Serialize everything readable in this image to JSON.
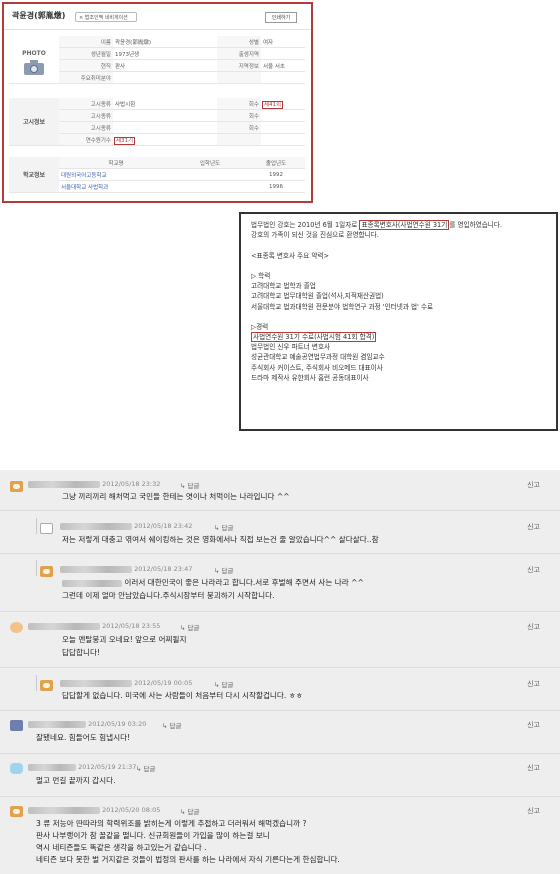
{
  "profile": {
    "name": "곽윤경(郭胤燉)",
    "tag": "× 법조인맥 네비게이션",
    "button": "인쇄하기",
    "photo_label": "PHOTO",
    "rows": [
      {
        "l1": "이름",
        "v1": "곽윤경(郭胤燉)",
        "l2": "성별",
        "v2": "여자"
      },
      {
        "l1": "생년월일",
        "v1": "1973년생",
        "l2": "출생지역",
        "v2": ""
      },
      {
        "l1": "현직",
        "v1": "판사",
        "l2": "지역정보",
        "v2": "서울 서초"
      },
      {
        "l1": "주요취미분야",
        "v1": "",
        "l2": "",
        "v2": ""
      }
    ],
    "exam_section": "고시정보",
    "exam_rows": [
      {
        "l1": "고시종류",
        "v1": "사법시험",
        "l2": "회수",
        "v2": "제41회"
      },
      {
        "l1": "고시종류",
        "v1": "",
        "l2": "회수",
        "v2": ""
      },
      {
        "l1": "고시종류",
        "v1": "",
        "l2": "회수",
        "v2": ""
      },
      {
        "l1": "연수원기수",
        "v1": "제31기",
        "l2": "",
        "v2": ""
      }
    ],
    "school_section": "학교정보",
    "school_headers": [
      "학교명",
      "입학년도",
      "졸업년도"
    ],
    "schools": [
      {
        "name": "대원외국어고등학교",
        "in": "",
        "out": "1992"
      },
      {
        "name": "서울대학교 사법학과",
        "in": "",
        "out": "1996"
      }
    ]
  },
  "article": {
    "lines": [
      {
        "pre": "법무법인 강호는 2010년 6월 1일자로 ",
        "hl": "표종록변호사(사법연수원 31기",
        "post": "를 영입하였습니다."
      },
      {
        "pre": "강호의 가족이 되신 것을 진심으로 환영합니다.",
        "hl": "",
        "post": ""
      },
      {
        "pre": "",
        "hl": "",
        "post": ""
      },
      {
        "pre": "<표종록 변호사 주요 약력>",
        "hl": "",
        "post": ""
      },
      {
        "pre": "",
        "hl": "",
        "post": ""
      },
      {
        "pre": "▷ 학력",
        "hl": "",
        "post": ""
      },
      {
        "pre": "고려대학교 법학과 졸업",
        "hl": "",
        "post": ""
      },
      {
        "pre": "고려대학교 법무대학원 졸업(석사,지적재산권법)",
        "hl": "",
        "post": ""
      },
      {
        "pre": "서울대학교 법과대학원 전문분야 법학연구 과정 '인터넷과 법' 수료",
        "hl": "",
        "post": ""
      },
      {
        "pre": "",
        "hl": "",
        "post": ""
      },
      {
        "pre": "▷경력",
        "hl": "",
        "post": ""
      },
      {
        "pre": "",
        "hl": "사법연수원 31기 수료(사법시험 41회 합격)",
        "post": ""
      },
      {
        "pre": "법무법인 신우 파트너 변호사",
        "hl": "",
        "post": ""
      },
      {
        "pre": "성균관대학교 예술공연법무과정 대학원 겸임교수",
        "hl": "",
        "post": ""
      },
      {
        "pre": "주식회사 커이스트, 주식회사 비오메드 대표이사",
        "hl": "",
        "post": ""
      },
      {
        "pre": "드라마 제작사 유한회사 홈런 공동대표이사",
        "hl": "",
        "post": ""
      }
    ]
  },
  "comments": {
    "report_label": "신고",
    "reply_label": "답글",
    "items": [
      {
        "date": "2012/05/18 23:32",
        "text": [
          "그냥 끼리끼리 해처먹고 국민들 한테는 엿이나 처먹이는 나라입니다 ^^"
        ]
      },
      {
        "date": "2012/05/18 23:42",
        "text": [
          "저는 저렇게 대충고 엮여서 쉐이킹하는 것은 영화에서나 직접 보는건 줄 알았습니다^^ 살다살다..참"
        ]
      },
      {
        "date": "2012/05/18 23:47",
        "text": [
          "이러서 대한민국이 좋은 나라라고 합니다.서로 후벌해 주면서 사는 나라 ^^",
          "그런데 이제 얼마 안남았습니다.주식시장부터 붕괴하기 시작합니다."
        ]
      },
      {
        "date": "2012/05/18 23:55",
        "text": [
          "오늘 멘탈붕괴 오네요! 앞으로 어찌될지",
          "답답합니다!"
        ]
      },
      {
        "date": "2012/05/19 00:05",
        "text": [
          "답답할게 없습니다. 미국에 사는 사람들이 처음부터 다시 시작할겁니다. ㅎㅎ"
        ]
      },
      {
        "date": "2012/05/19 03:20",
        "text": [
          "잘됐네요. 힘들어도 힘냅시다!"
        ]
      },
      {
        "date": "2012/05/19 21:37",
        "text": [
          "멀고 먼길 끝까지 갑시다."
        ]
      },
      {
        "date": "2012/05/20 08:05",
        "text": [
          "3 류 저능아 딴따라의 학력위조를 밝히는게 이렇게 추접하고 더러워서 해먹겠습니까 ?",
          "판사 나부랭이가 참 꼴같을 떨니다. 신규회원들이 가입을 많이 하는걸 보니",
          "역시 네티즌들도 똑같은 생각을 하고있는거 같습니다 .",
          "네티즌 보다 못한 벌 거지같은 것들이 법정의 판사를 하는 나라에서 자식 기른다는게 한심합니다."
        ]
      }
    ]
  }
}
